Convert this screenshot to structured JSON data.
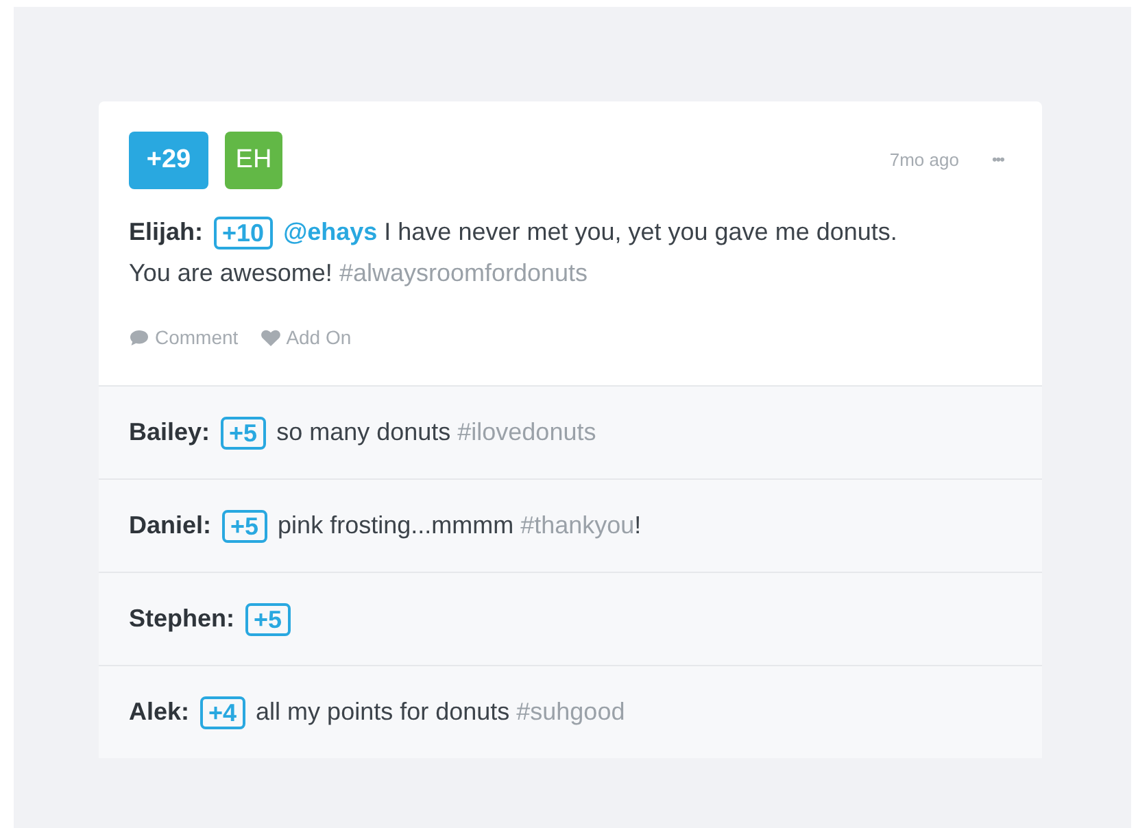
{
  "post": {
    "points": "+29",
    "avatar": {
      "initials": "EH",
      "color": "#62b846"
    },
    "time": "7mo ago",
    "more": "•••",
    "author": "Elijah:",
    "badge": "+10",
    "message": [
      {
        "kind": "mention",
        "text": "@ehays"
      },
      {
        "kind": "text",
        "text": " I have never met you, yet you gave me donuts."
      }
    ],
    "message_continued": [
      {
        "kind": "text",
        "text": "You are awesome! "
      },
      {
        "kind": "hashtag",
        "text": "#alwaysroomfordonuts"
      }
    ],
    "actions": [
      {
        "kind": "comment",
        "label": "Comment"
      },
      {
        "kind": "like",
        "label": "Add On"
      }
    ]
  },
  "replies": [
    {
      "author": "Bailey:",
      "badge": "+5",
      "message": [
        {
          "kind": "text",
          "text": "so many donuts "
        },
        {
          "kind": "hashtag",
          "text": "#ilovedonuts"
        }
      ]
    },
    {
      "author": "Daniel:",
      "badge": "+5",
      "message": [
        {
          "kind": "text",
          "text": "pink frosting...mmmm "
        },
        {
          "kind": "hashtag",
          "text": "#thankyou"
        },
        {
          "kind": "text",
          "text": "!"
        }
      ]
    },
    {
      "author": "Stephen:",
      "badge": "+5"
    },
    {
      "author": "Alek:",
      "badge": "+4",
      "message": [
        {
          "kind": "text",
          "text": "all my points for donuts "
        },
        {
          "kind": "hashtag",
          "text": "#suhgood"
        }
      ]
    }
  ]
}
